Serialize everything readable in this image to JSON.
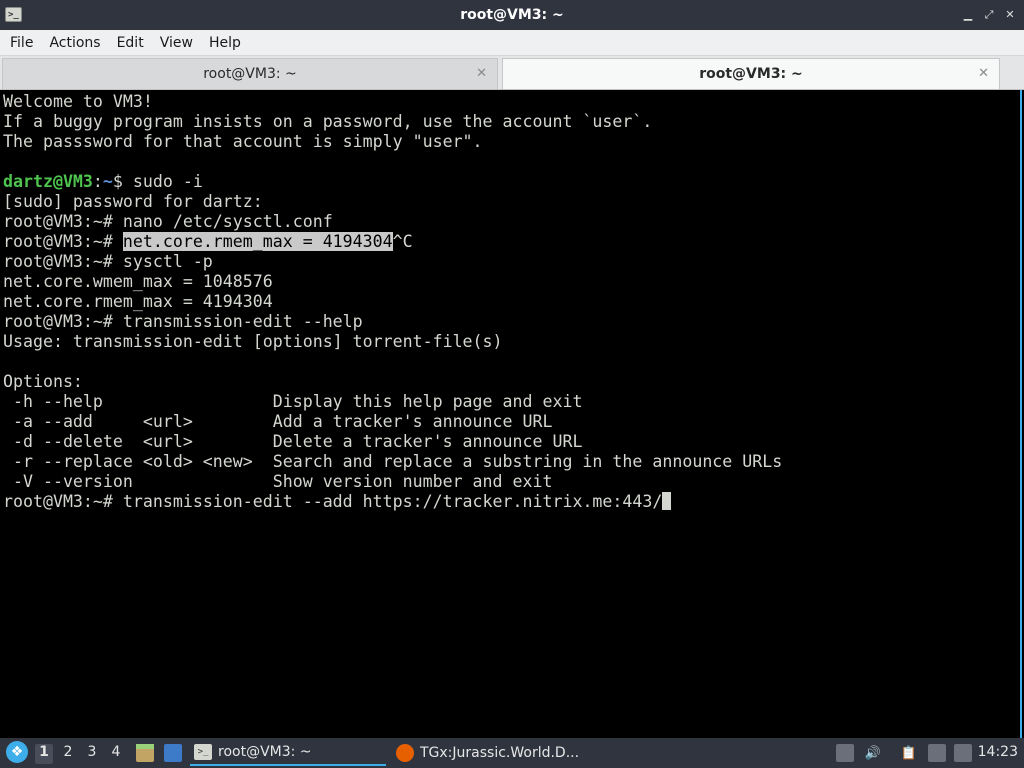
{
  "window": {
    "title": "root@VM3: ~",
    "app_icon_glyph": ">_",
    "controls": {
      "minimize": "▁",
      "restore": "⤢",
      "close": "✕"
    }
  },
  "menubar": {
    "items": [
      "File",
      "Actions",
      "Edit",
      "View",
      "Help"
    ]
  },
  "tabs": [
    {
      "label": "root@VM3: ~",
      "close": "✕",
      "active": false
    },
    {
      "label": "root@VM3: ~",
      "close": "✕",
      "active": true
    }
  ],
  "terminal": {
    "lines": [
      "Welcome to VM3!",
      "If a buggy program insists on a password, use the account `user`.",
      "The passsword for that account is simply \"user\".",
      "",
      "",
      "[sudo] password for dartz:",
      "root@VM3:~# nano /etc/sysctl.conf",
      "",
      "root@VM3:~# sysctl -p",
      "net.core.wmem_max = 1048576",
      "net.core.rmem_max = 4194304",
      "root@VM3:~# transmission-edit --help",
      "Usage: transmission-edit [options] torrent-file(s)",
      "",
      "Options:",
      " -h --help                 Display this help page and exit",
      " -a --add     <url>        Add a tracker's announce URL",
      " -d --delete  <url>        Delete a tracker's announce URL",
      " -r --replace <old> <new>  Search and replace a substring in the announce URLs",
      " -V --version              Show version number and exit",
      ""
    ],
    "user_prompt": {
      "user": "dartz@VM3",
      "sep": ":",
      "path": "~",
      "symbol": "$ ",
      "command": "sudo -i"
    },
    "highlight_line": {
      "prompt": "root@VM3:~# ",
      "selected": "net.core.rmem_max = 4194304",
      "rest": "^C"
    },
    "current_line": {
      "prompt": "root@VM3:~# ",
      "command": "transmission-edit --add https://tracker.nitrix.me:443/"
    }
  },
  "taskbar": {
    "workspaces": [
      "1",
      "2",
      "3",
      "4"
    ],
    "active_workspace": "1",
    "tasks": [
      {
        "label": "root@VM3: ~",
        "icon": "terminal-icon",
        "icon_glyph": ">_"
      },
      {
        "label": "TGx:Jurassic.World.D...",
        "icon": "firefox-icon"
      }
    ],
    "tray": {
      "volume_glyph": "🔊",
      "clipboard_glyph": "📋"
    },
    "clock": "14:23"
  },
  "colors": {
    "titlebar": "#2f343f",
    "terminal_bg": "#000000",
    "terminal_fg": "#d3d7cf",
    "user_green": "#4ec34e",
    "path_blue": "#5e8fd6",
    "accent": "#3daee9"
  }
}
